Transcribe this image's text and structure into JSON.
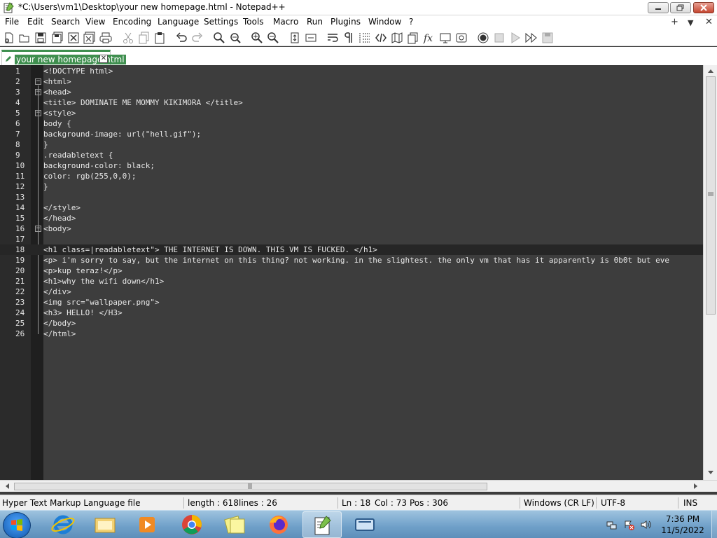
{
  "window": {
    "title": "*C:\\Users\\vm1\\Desktop\\your new homepage.html - Notepad++"
  },
  "menu": [
    "File",
    "Edit",
    "Search",
    "View",
    "Encoding",
    "Language",
    "Settings",
    "Tools",
    "Macro",
    "Run",
    "Plugins",
    "Window",
    "?"
  ],
  "menu_right": {
    "plus": "+",
    "dropdown": "▼",
    "close": "✕"
  },
  "tab": {
    "label": "your new homepage.html",
    "close": "✕"
  },
  "editor": {
    "lines": [
      {
        "n": "1",
        "text": "<!DOCTYPE html>"
      },
      {
        "n": "2",
        "text": "<html>"
      },
      {
        "n": "3",
        "text": "<head>"
      },
      {
        "n": "4",
        "text": "<title> DOMINATE ME MOMMY KIKIMORA </title>"
      },
      {
        "n": "5",
        "text": "<style>"
      },
      {
        "n": "6",
        "text": "body {"
      },
      {
        "n": "7",
        "text": "background-image: url(\"hell.gif\");"
      },
      {
        "n": "8",
        "text": "}"
      },
      {
        "n": "9",
        "text": ".readabletext {"
      },
      {
        "n": "10",
        "text": "background-color: black;"
      },
      {
        "n": "11",
        "text": "color: rgb(255,0,0);"
      },
      {
        "n": "12",
        "text": "}"
      },
      {
        "n": "13",
        "text": ""
      },
      {
        "n": "14",
        "text": "</style>"
      },
      {
        "n": "15",
        "text": "</head>"
      },
      {
        "n": "16",
        "text": "<body>"
      },
      {
        "n": "17",
        "text": ""
      },
      {
        "n": "18",
        "text": "<h1 class=|readabletext\"> THE INTERNET IS DOWN. THIS VM IS FUCKED. </h1>"
      },
      {
        "n": "19",
        "text": "<p> i'm sorry to say, but the internet on this thing? not working. in the slightest. the only vm that has it apparently is 0b0t but eve"
      },
      {
        "n": "20",
        "text": "<p>kup teraz!</p>"
      },
      {
        "n": "21",
        "text": "<h1>why the wifi down</h1>"
      },
      {
        "n": "22",
        "text": "</div>"
      },
      {
        "n": "23",
        "text": "<img src=\"wallpaper.png\">"
      },
      {
        "n": "24",
        "text": "<h3> HELLO! </H3>"
      },
      {
        "n": "25",
        "text": "</body>"
      },
      {
        "n": "26",
        "text": "</html>"
      }
    ],
    "current_line": "18"
  },
  "status": {
    "filetype": "Hyper Text Markup Language file",
    "length": "length : 618",
    "lines": "lines : 26",
    "ln": "Ln : 18",
    "col": "Col : 73",
    "pos": "Pos : 306",
    "eol": "Windows (CR LF)",
    "encoding": "UTF-8",
    "mode": "INS"
  },
  "taskbar": {
    "time": "7:36 PM",
    "date": "11/5/2022"
  },
  "colors": {
    "accent": "#3f8f4f",
    "editor_bg": "#3d3d3d"
  }
}
